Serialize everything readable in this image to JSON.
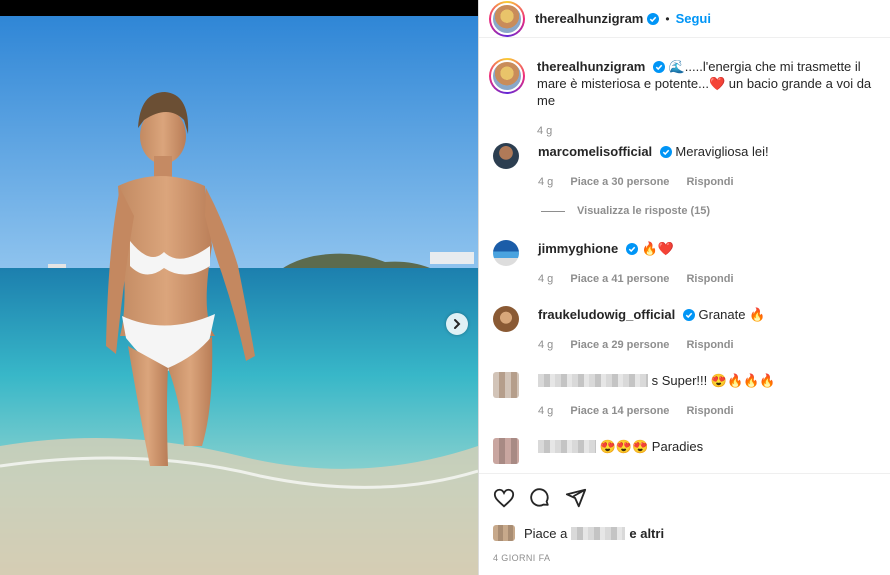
{
  "post": {
    "author": "therealhunzigram",
    "follow_label": "Segui",
    "separator": "•",
    "caption": "🌊.....l'energia che mi trasmette il mare è misteriosa e potente...❤️ un bacio grande a voi da me",
    "caption_time": "4 g",
    "view_replies": "Visualizza le risposte (15)",
    "likes_prefix": "Piace a",
    "likes_suffix": "e altri",
    "date": "4 GIORNI FA"
  },
  "comments": [
    {
      "user": "marcomelisofficial",
      "text": "Meravigliosa lei!",
      "time": "4 g",
      "likes": "Piace a 30 persone",
      "reply": "Rispondi"
    },
    {
      "user": "jimmyghione",
      "text": "🔥❤️",
      "time": "4 g",
      "likes": "Piace a 41 persone",
      "reply": "Rispondi"
    },
    {
      "user": "fraukeludowig_official",
      "text": "Granate 🔥",
      "time": "4 g",
      "likes": "Piace a 29 persone",
      "reply": "Rispondi"
    },
    {
      "user": "",
      "text": "s Super!!! 😍🔥🔥🔥",
      "time": "4 g",
      "likes": "Piace a 14 persone",
      "reply": "Rispondi"
    },
    {
      "user": "",
      "text": "😍😍😍 Paradies",
      "time": "",
      "likes": "",
      "reply": ""
    }
  ],
  "icons": [
    "verified-icon",
    "heart-icon",
    "comment-icon",
    "share-icon",
    "chevron-right-icon"
  ],
  "colors": {
    "accent": "#0095f6",
    "verified": "#0095f6",
    "text": "#262626",
    "muted": "#8e8e8e"
  }
}
